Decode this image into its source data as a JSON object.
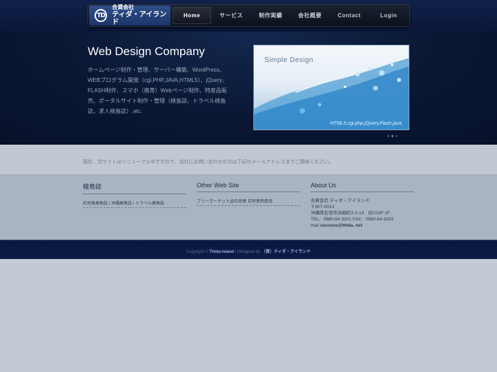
{
  "header": {
    "logo": {
      "mark": "TD",
      "line1": "合資会社",
      "line2": "ティダ・アイランド"
    },
    "menu": [
      {
        "label": "Home",
        "active": true
      },
      {
        "label": "サービス"
      },
      {
        "label": "制作実績"
      },
      {
        "label": "会社概要"
      },
      {
        "label": "Contact"
      },
      {
        "label": "Login"
      }
    ]
  },
  "hero": {
    "title": "Web Design Company",
    "description": "ホームページ制作・管理、サーバー構築、WordPress、WEBプログラム開発（cgi,PHP,JAVA,HTML5）、jQuery、FLASH制作、スマホ（携帯）Webページ制作、特産品販売、ポータルサイト制作・管理（検島誌、トラベル検島誌、求人検島誌）,etc.",
    "slide": {
      "title": "Simple Design",
      "caption": "HTML5,cgi,php,jQuery,Flash,java"
    }
  },
  "notice": {
    "text": "現在、当サイトはリニューアル中ですので、当社にお問い合わせの方は下記のメールアドレスまでご連絡ください。"
  },
  "columns": {
    "col1": {
      "title": "検島誌",
      "link": "石垣島検島誌 / 沖縄検島誌 / トラベル検島誌"
    },
    "col2": {
      "title": "Other Web Site",
      "link": "フリーマーケット@石垣島 石垣島特産品"
    },
    "about": {
      "title": "About Us",
      "company": "合資会社 ティダ・アイランド",
      "postal": "〒907-0013",
      "address": "沖縄県石垣市浜崎町2-2-13　砂川AP 1F",
      "tel": "TEL：0980-84-3301 FAX：0980-84-3303",
      "mail_label": "mail",
      "mail": "success@thida. net"
    }
  },
  "footer": {
    "copyright": "Copyright ©",
    "site": "Thida-island",
    "designed": "| Designed by",
    "designer": "（資）ティダ・アイランド"
  },
  "colors": {
    "header_bg": "#0b1738",
    "notice_bg": "#c0c8d4",
    "columns_bg": "#a9b3c1",
    "footer_bg": "#0d1c47"
  }
}
